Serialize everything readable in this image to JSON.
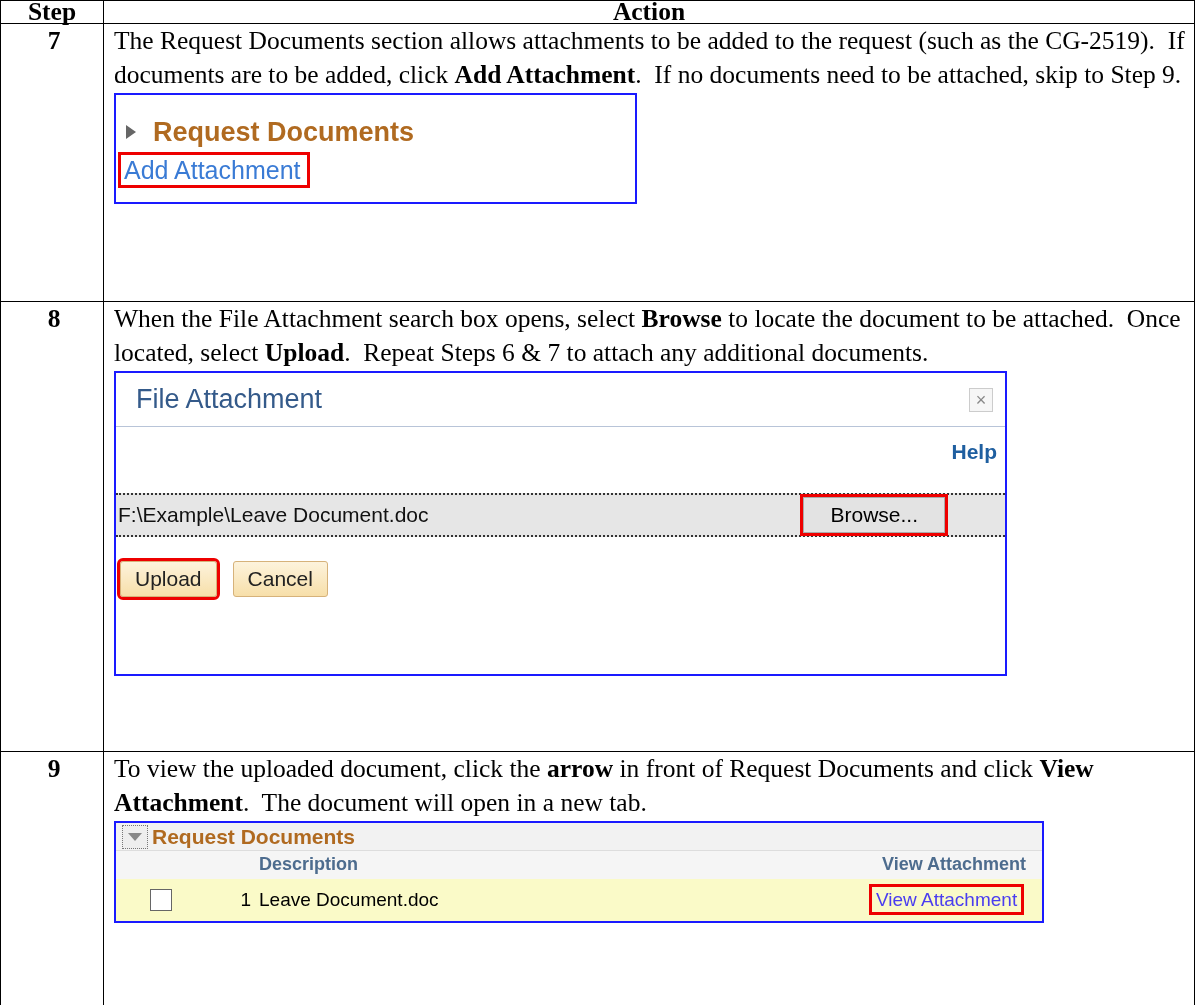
{
  "table": {
    "columns": [
      "Step",
      "Action"
    ],
    "rows": [
      {
        "step": "7",
        "text": "The Request Documents section allows attachments to be added to the request (such as the CG-2519).  If documents are to be added, click **Add Attachment**.  If no documents need to be attached, skip to Step 9.",
        "screenshot": {
          "kind": "section",
          "title": "Request Documents",
          "expanded": false,
          "link": {
            "label": "Add Attachment",
            "highlighted": true
          }
        }
      },
      {
        "step": "8",
        "text": "When the File Attachment search box opens, select **Browse** to locate the document to be attached.  Once located, select **Upload**.  Repeat Steps 6 & 7 to attach any additional documents.",
        "screenshot": {
          "kind": "dialog",
          "title": "File Attachment",
          "close": "×",
          "help": "Help",
          "file_path": "F:\\Example\\Leave Document.doc",
          "browse": {
            "label": "Browse...",
            "highlighted": true
          },
          "buttons": [
            {
              "label": "Upload",
              "highlighted": true
            },
            {
              "label": "Cancel",
              "highlighted": false
            }
          ]
        }
      },
      {
        "step": "9",
        "text": "To view the uploaded document, click the **arrow** in front of Request Documents and click **View Attachment**.  The document will open in a new tab.",
        "screenshot": {
          "kind": "grid",
          "title": "Request Documents",
          "expanded": true,
          "columns": [
            "Description",
            "View Attachment"
          ],
          "rows": [
            {
              "checked": false,
              "number": "1",
              "description": "Leave Document.doc",
              "link": {
                "label": "View Attachment",
                "highlighted": true
              }
            }
          ]
        }
      }
    ]
  }
}
